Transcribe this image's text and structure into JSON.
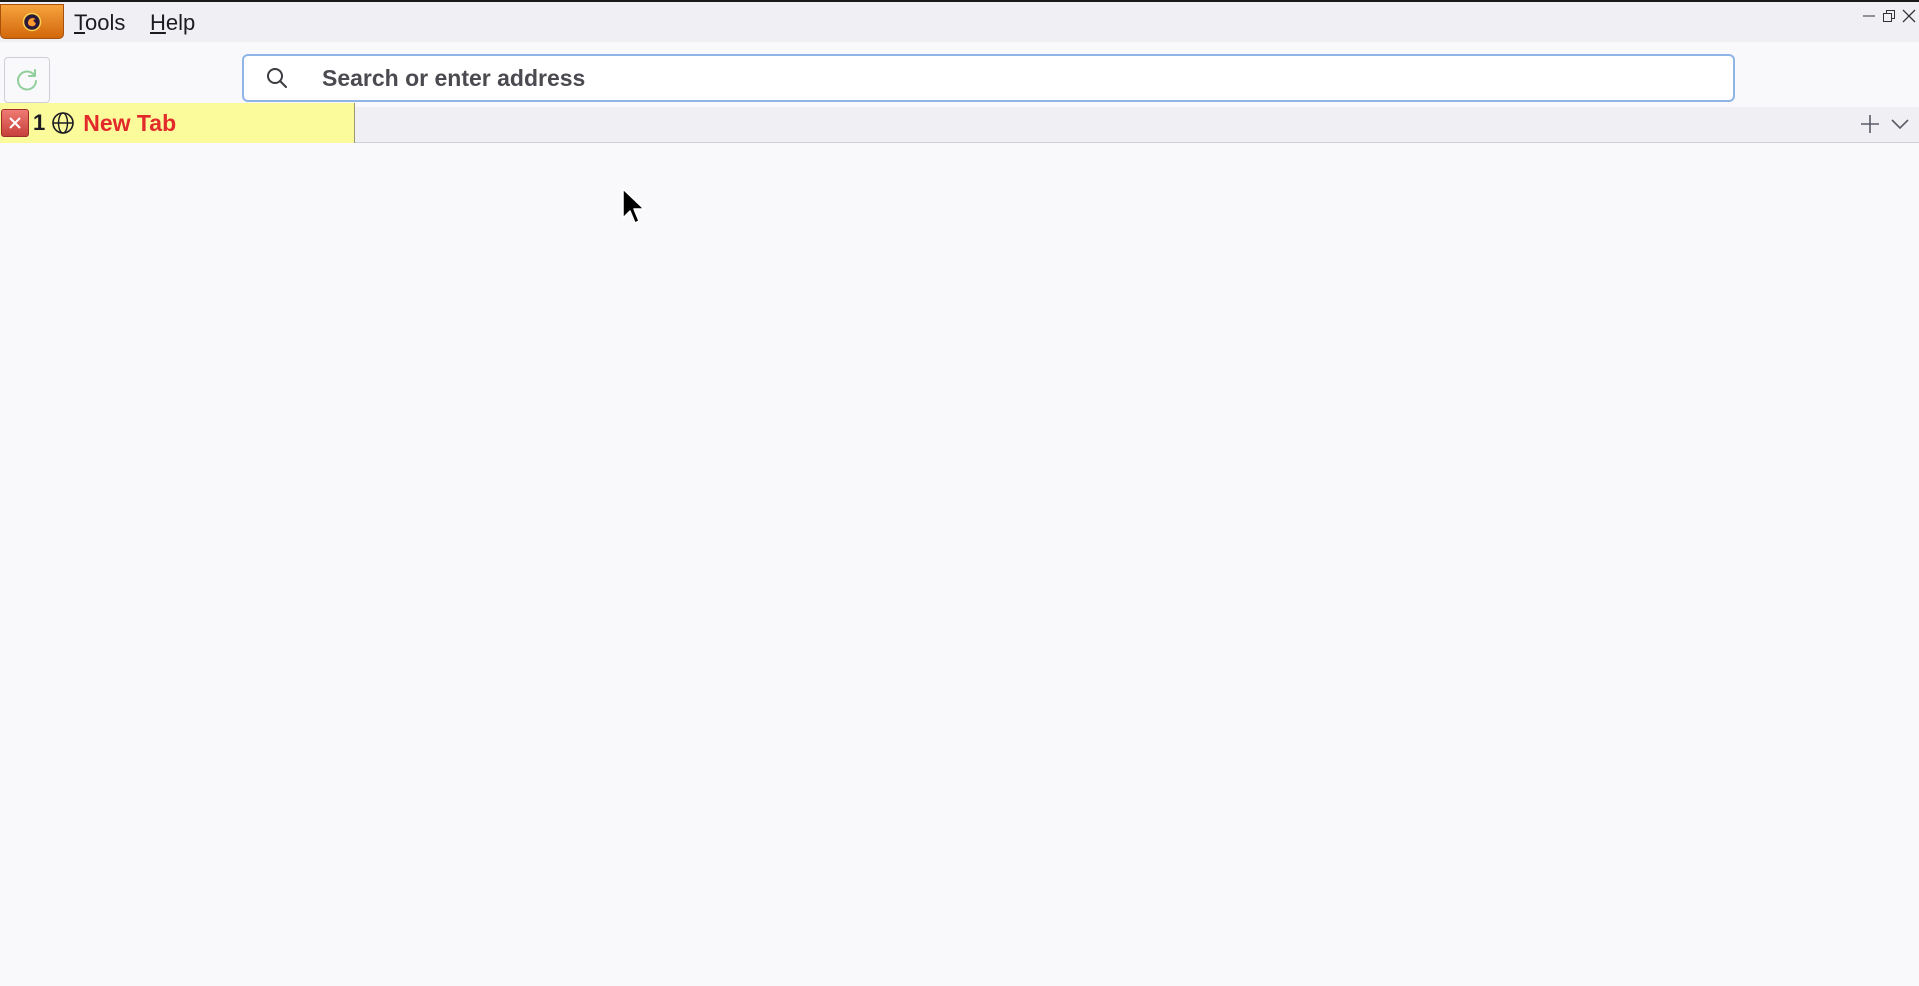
{
  "menubar": {
    "items": [
      {
        "accel": "T",
        "rest": "ools"
      },
      {
        "accel": "H",
        "rest": "elp"
      }
    ]
  },
  "navbar": {
    "urlbar": {
      "placeholder": "Search or enter address",
      "value": ""
    }
  },
  "tabs": [
    {
      "index": "1",
      "title": "New Tab",
      "icon": "globe-icon",
      "active": true
    }
  ],
  "colors": {
    "app_button": "#e8821e",
    "tab_background": "#fbfb9c",
    "tab_title": "#e22a2a",
    "urlbar_border": "#8fb4e8",
    "content_background": "#f9f9fb"
  }
}
